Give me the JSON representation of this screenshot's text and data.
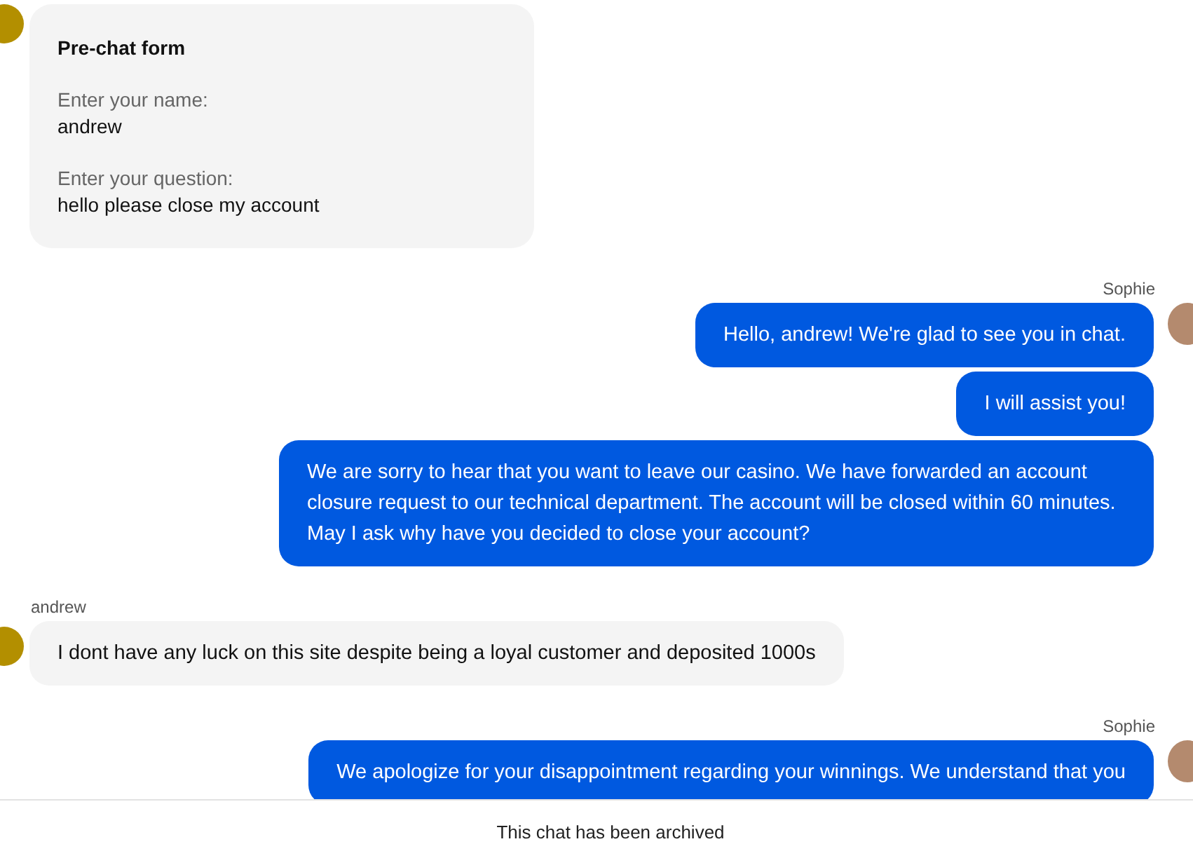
{
  "messages": [
    {
      "kind": "visitor_form",
      "title": "Pre-chat form",
      "fields": [
        {
          "label": "Enter your name:",
          "value": "andrew"
        },
        {
          "label": "Enter your question:",
          "value": "hello please close my account"
        }
      ]
    },
    {
      "kind": "agent_group",
      "author": "Sophie",
      "bubbles": [
        "Hello, andrew! We're glad to see you in chat.",
        "I will assist you!",
        "We are sorry to hear that you want to leave our casino. We have forwarded an account closure request to our technical department. The account will be closed within 60 minutes. May I ask why have you decided to close your account?"
      ]
    },
    {
      "kind": "visitor_group",
      "author": "andrew",
      "bubbles": [
        "I dont have any luck on this site despite being a loyal customer and deposited 1000s"
      ]
    },
    {
      "kind": "agent_group",
      "author": "Sophie",
      "bubbles": [
        "We apologize for your disappointment regarding your winnings. We understand that you"
      ]
    }
  ],
  "footer": {
    "notice": "This chat has been archived"
  }
}
